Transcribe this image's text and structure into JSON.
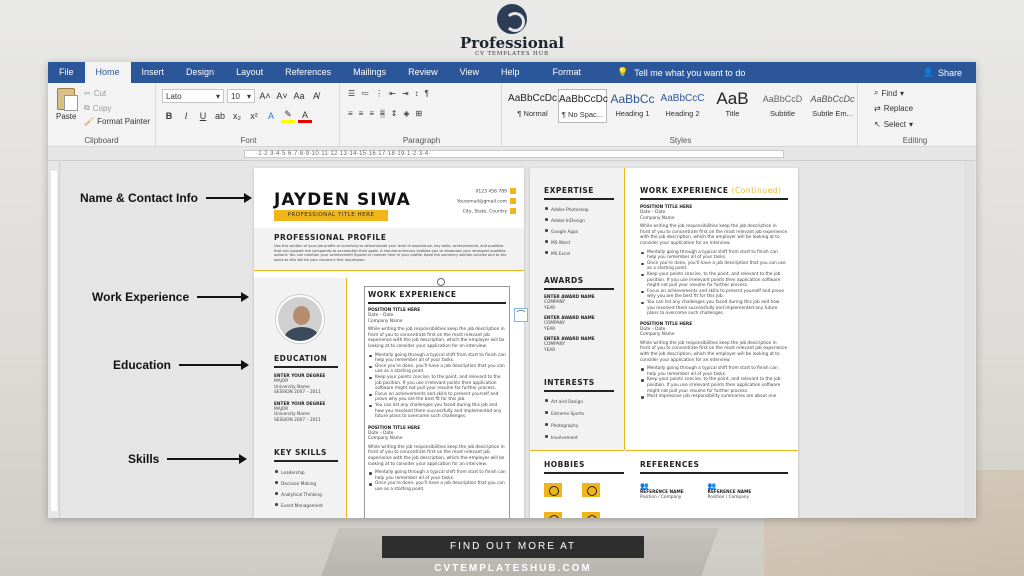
{
  "brand": {
    "name": "Professional",
    "sub": "CV TEMPLATES HUB"
  },
  "menubar": {
    "tabs": [
      "File",
      "Home",
      "Insert",
      "Design",
      "Layout",
      "References",
      "Mailings",
      "Review",
      "View",
      "Help",
      "Format"
    ],
    "active": "Home",
    "tell_me": "Tell me what you want to do",
    "share": "Share"
  },
  "ribbon": {
    "clipboard": {
      "paste": "Paste",
      "cut": "Cut",
      "copy": "Copy",
      "format_painter": "Format Painter",
      "label": "Clipboard"
    },
    "font": {
      "name": "Lato",
      "size": "10",
      "label": "Font"
    },
    "paragraph": {
      "label": "Paragraph"
    },
    "styles": {
      "label": "Styles",
      "items": [
        {
          "sample": "AaBbCcDc",
          "name": "¶ Normal"
        },
        {
          "sample": "AaBbCcDc",
          "name": "¶ No Spac..."
        },
        {
          "sample": "AaBbCc",
          "name": "Heading 1"
        },
        {
          "sample": "AaBbCcC",
          "name": "Heading 2"
        },
        {
          "sample": "AaB",
          "name": "Title"
        },
        {
          "sample": "AaBbCcD",
          "name": "Subtitle"
        },
        {
          "sample": "AaBbCcDc",
          "name": "Subtle Em..."
        }
      ]
    },
    "editing": {
      "find": "Find",
      "replace": "Replace",
      "select": "Select",
      "label": "Editing"
    }
  },
  "annotations": [
    "Name & Contact Info",
    "Work Experience",
    "Education",
    "Skills"
  ],
  "resume": {
    "name": "JAYDEN SIWA",
    "title": "PROFESSIONAL TITLE HERE",
    "contact": [
      "0123 456 789",
      "Youremail@gmail.com",
      "City, State, Country"
    ],
    "profile_heading": "PROFESSIONAL PROFILE",
    "profile_text": "Use this section of your job profile or summary to demonstrate your level of experience, key skills, achievements, and qualities that can support the companies to accomplish their goals. A resume summary enables you to showcase your strongest qualities upfront. You can mention your achievement figures or number here in your profile. Keep the summary section concise and to the point as this will be your resume's first impression.",
    "work_heading": "WORK EXPERIENCE",
    "job_title": "POSITION TITLE HERE",
    "job_date": "Date – Date",
    "company": "Company Name",
    "job_intro": "While writing the job responsibilities keep the job description in front of you to concentrate first on the most relevant job experience with the job description, which the employer will be looking at to consider your application for an interview.",
    "job_bullets": [
      "Mentally going through a typical shift from start to finish can help you remember all of your tasks.",
      "Once you're done, you'll have a job description that you can use as a starting point.",
      "Keep your points concise, to the point, and relevant to the job position. If you use irrelevant points then application software might not pull your resume for further process.",
      "Focus on achievements and skills to present yourself and prove why you are the best fit for this job.",
      "You can list any challenges you faced during this job and how you resolved them successfully and implemented any future plans to overcome such challenges."
    ],
    "job_bullets_short": [
      "Mentally going through a typical shift from start to finish can help you remember all of your tasks.",
      "Keep your points concise, to the point, and relevant to the job position. If you use irrelevant points then application software might not pull your resume for further process.",
      "Most impressive job responsibility summaries are about one"
    ],
    "education_heading": "EDUCATION",
    "education": [
      {
        "degree": "ENTER YOUR DEGREE",
        "major": "MAJOR",
        "school": "University Name",
        "session": "SESSION 2007 – 2011"
      },
      {
        "degree": "ENTER YOUR DEGREE",
        "major": "MAJOR",
        "school": "University Name",
        "session": "SESSION 2007 – 2011"
      }
    ],
    "skills_heading": "KEY SKILLS",
    "skills": [
      "Leadership",
      "Decision Making",
      "Analytical Thinking",
      "Event Management"
    ],
    "expertise_heading": "EXPERTISE",
    "expertise": [
      "Adobe Photoshop",
      "Adobe InDesign",
      "Google Apps",
      "MS Word",
      "MS Excel"
    ],
    "awards_heading": "AWARDS",
    "award": {
      "name": "ENTER AWARD NAME",
      "company": "COMPANY",
      "year": "YEAR"
    },
    "interests_heading": "INTERESTS",
    "interests": [
      "Art and Design",
      "Extreme Sports",
      "Photography",
      "Involvement"
    ],
    "hobbies_heading": "HOBBIES",
    "work_heading_cont": "WORK EXPERIENCE",
    "continued": "(Continued)",
    "references_heading": "REFERENCES",
    "reference": {
      "name": "REFERENCE NAME",
      "position": "Position / Company"
    }
  },
  "footer": {
    "prefix": "FIND OUT MORE AT",
    "site": "CVTEMPLATESHUB.COM"
  },
  "colors": {
    "accent": "#f1b51c",
    "word_blue": "#2b579a"
  }
}
